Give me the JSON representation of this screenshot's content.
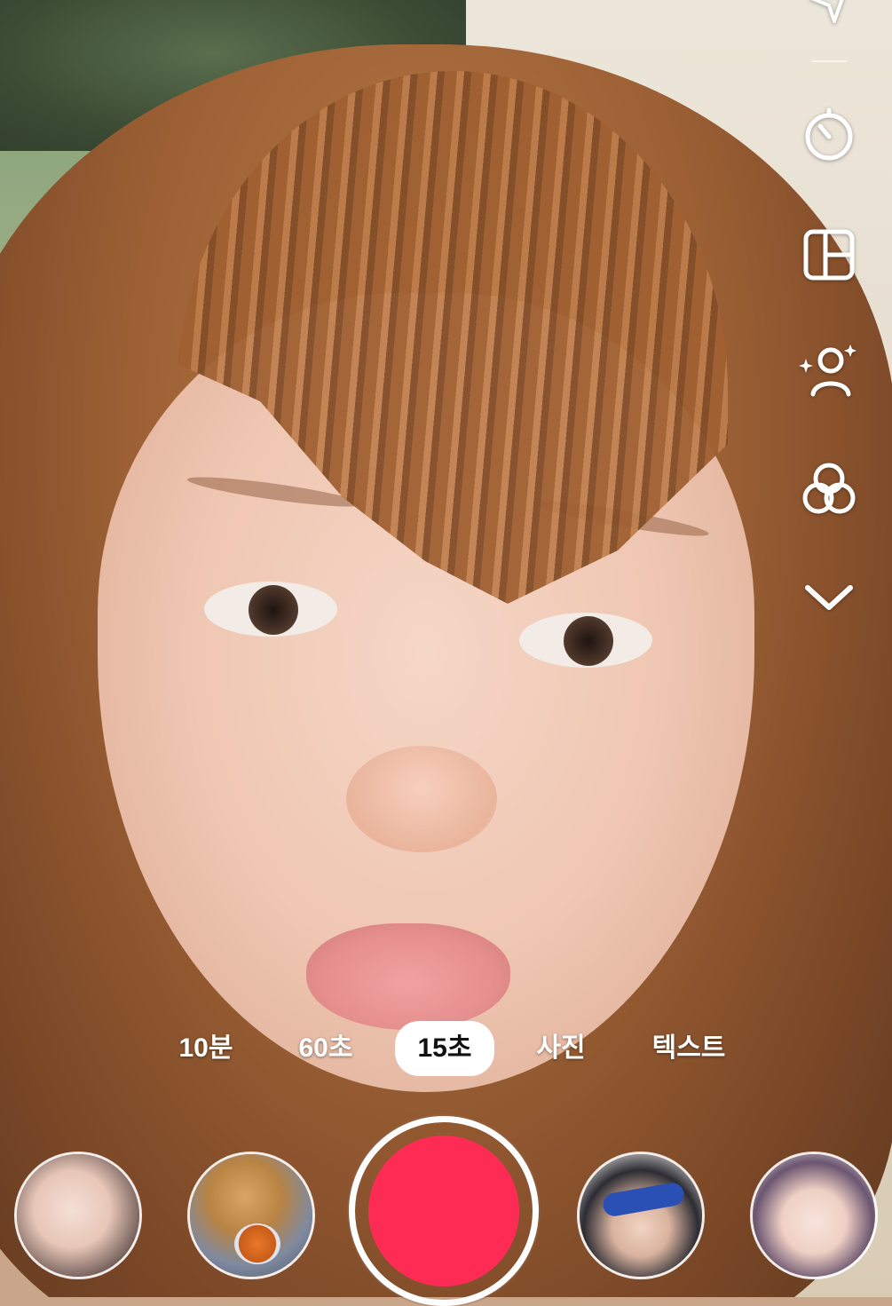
{
  "toolbar": {
    "items": [
      {
        "name": "flip-camera",
        "icon": "flip-arrow-icon"
      },
      {
        "name": "timer",
        "icon": "timer-icon"
      },
      {
        "name": "layout",
        "icon": "layout-grid-icon"
      },
      {
        "name": "beauty",
        "icon": "face-sparkle-icon"
      },
      {
        "name": "filters",
        "icon": "filter-circles-icon"
      },
      {
        "name": "more",
        "icon": "chevron-down-icon"
      }
    ]
  },
  "modes": {
    "items": [
      "10분",
      "60초",
      "15초",
      "사진",
      "텍스트"
    ],
    "active": "15초"
  },
  "record": {
    "color": "#fe2c55",
    "icon": "record-button"
  },
  "effects": {
    "items": [
      {
        "name": "effect-portrait-beauty"
      },
      {
        "name": "effect-dog-meme"
      },
      {
        "name": "effect-face-doodle"
      },
      {
        "name": "effect-anime-cat"
      }
    ]
  }
}
